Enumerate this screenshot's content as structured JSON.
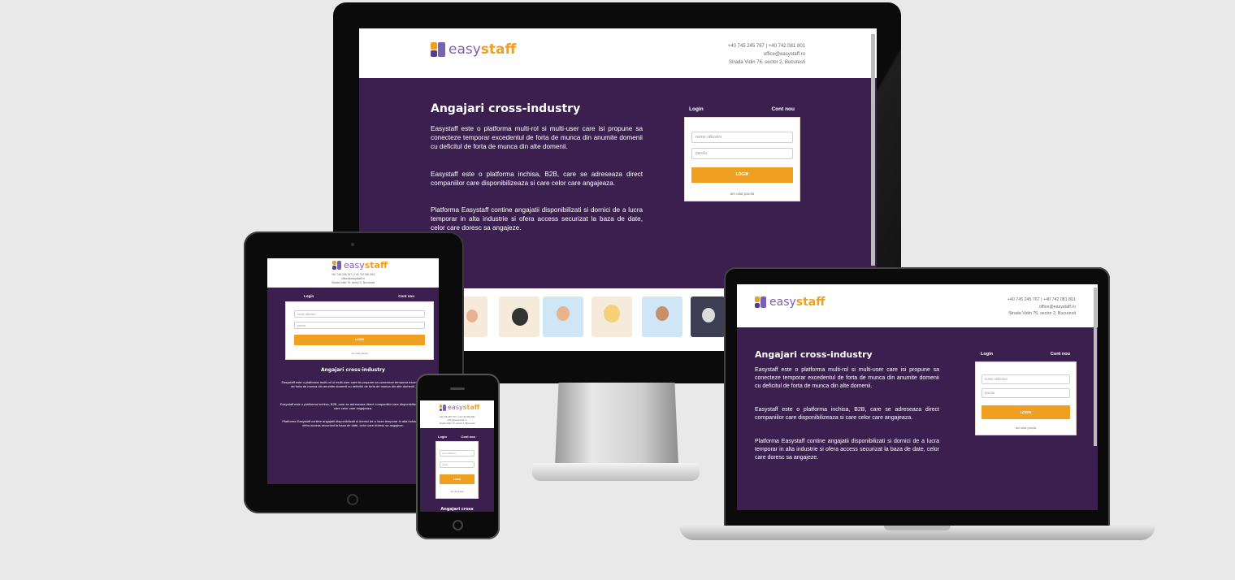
{
  "site": {
    "brand_part1": "easy",
    "brand_part2": "staff",
    "contact": {
      "phones": "+40 745 245 767 | +40 742 081 801",
      "email": "office@easystaff.ro",
      "address": "Strada Vidin 76, sector 2, Bucuresti"
    },
    "headline": "Angajari cross-industry",
    "paragraphs": [
      "Easystaff este o platforma multi-rol si multi-user care isi propune sa conecteze temporar excedentul de forta de munca din anumite domenii cu deficitul de forta de munca din alte domenii.",
      "Easystaff este o platforma inchisa, B2B, care se adreseaza direct companiilor care disponibilizeaza si care celor care angajeaza.",
      "Platforma Easystaff contine angajatii disponibilizati si dornici de a lucra temporar in alta industrie si ofera access securizat la baza de date, celor care doresc sa angajeze."
    ],
    "login": {
      "tab_login": "Login",
      "tab_register": "Cont nou",
      "username_placeholder": "nume utilizator",
      "password_placeholder": "parola",
      "button": "LOGIN",
      "forgot": "am uitat parola"
    },
    "truncated_headline": "Angajari cross"
  },
  "colors": {
    "background": "#e9e9e9",
    "main_purple": "#3b1f4f",
    "accent_orange": "#f0a020",
    "brand_purple": "#7b5fb0"
  }
}
